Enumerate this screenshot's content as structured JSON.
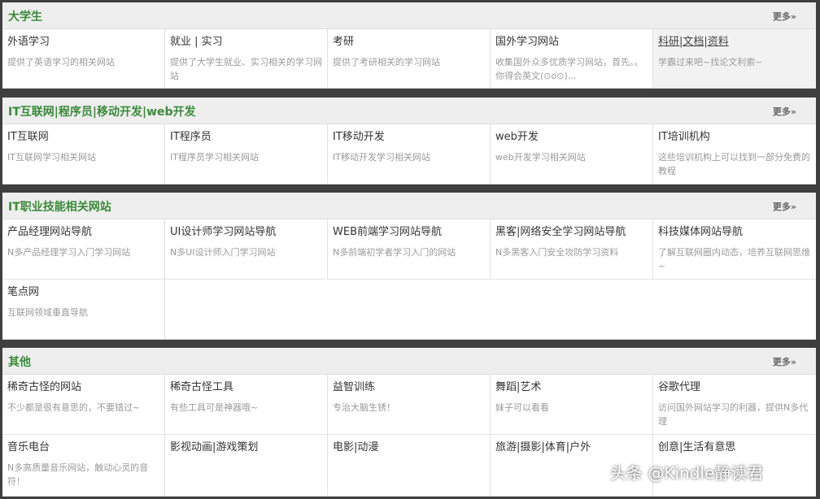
{
  "colors": {
    "title_green": "#3a8a3a",
    "header_bg": "#eeeeee",
    "frame": "#3f3f3f"
  },
  "sections": [
    {
      "title": "大学生",
      "more": "更多»",
      "items": [
        {
          "title": "外语学习",
          "desc": "提供了英语学习的相关网站"
        },
        {
          "title": "就业 | 实习",
          "desc": "提供了大学生就业、实习相关的学习网站"
        },
        {
          "title": "考研",
          "desc": "提供了考研相关的学习网站"
        },
        {
          "title": "国外学习网站",
          "desc": "收集国外众多优质学习网站，首先。。你得会英文(⊙o⊙)..."
        },
        {
          "title": "科研|文档|资料",
          "desc": "学霸过来吧~找论文利索~"
        }
      ]
    },
    {
      "title": "IT互联网|程序员|移动开发|web开发",
      "more": "更多»",
      "items": [
        {
          "title": "IT互联网",
          "desc": "IT互联网学习相关网站"
        },
        {
          "title": "IT程序员",
          "desc": "IT程序员学习相关网站"
        },
        {
          "title": "IT移动开发",
          "desc": "IT移动开发学习相关网站"
        },
        {
          "title": "web开发",
          "desc": "web开发学习相关网站"
        },
        {
          "title": "IT培训机构",
          "desc": "这些培训机构上可以找到一部分免费的教程"
        }
      ]
    },
    {
      "title": "IT职业技能相关网站",
      "more": "更多»",
      "items": [
        {
          "title": "产品经理网站导航",
          "desc": "N多产品经理学习入门学习网站"
        },
        {
          "title": "UI设计师学习网站导航",
          "desc": "N多UI设计师入门学习网站"
        },
        {
          "title": "WEB前端学习网站导航",
          "desc": "N多前端初学者学习入门的网站"
        },
        {
          "title": "黑客|网络安全学习网站导航",
          "desc": "N多黑客入门安全攻防学习资料"
        },
        {
          "title": "科技媒体网站导航",
          "desc": "了解互联网圈内动态，培养互联网思维~"
        },
        {
          "title": "笔点网",
          "desc": "互联网领域垂直导航"
        }
      ]
    },
    {
      "title": "其他",
      "more": "更多»",
      "items": [
        {
          "title": "稀奇古怪的网站",
          "desc": "不少都是很有意思的，不要错过~"
        },
        {
          "title": "稀奇古怪工具",
          "desc": "有些工具可是神器哦~"
        },
        {
          "title": "益智训练",
          "desc": "专治大脑生锈！"
        },
        {
          "title": "舞蹈|艺术",
          "desc": "妹子可以看看"
        },
        {
          "title": "谷歌代理",
          "desc": "访问国外网站学习的利器，提供N多代理"
        },
        {
          "title": "音乐电台",
          "desc": "N多高质量音乐网站，触动心灵的音符！"
        },
        {
          "title": "影视动画|游戏策划",
          "desc": ""
        },
        {
          "title": "电影|动漫",
          "desc": ""
        },
        {
          "title": "旅游|摄影|体育|户外",
          "desc": ""
        },
        {
          "title": "创意|生活有意思",
          "desc": ""
        }
      ]
    }
  ],
  "watermark": "头条 @Kindle静读君"
}
